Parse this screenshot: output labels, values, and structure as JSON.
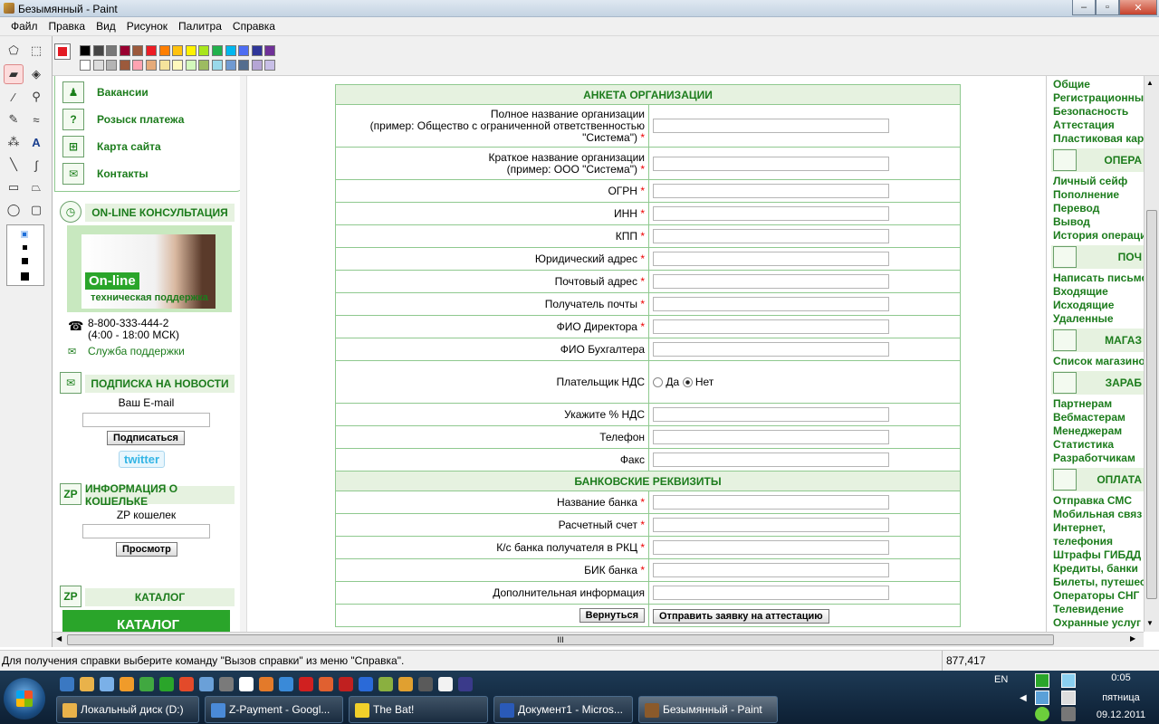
{
  "window": {
    "title": "Безымянный - Paint",
    "min": "–",
    "max": "▫",
    "close": "✕"
  },
  "menu": [
    "Файл",
    "Правка",
    "Вид",
    "Рисунок",
    "Палитра",
    "Справка"
  ],
  "palette": {
    "primary": "#e31b23",
    "row1": [
      "#000000",
      "#464646",
      "#787878",
      "#990030",
      "#9c5a3c",
      "#ed1c24",
      "#ff7e00",
      "#ffc20e",
      "#fff200",
      "#a8e61d",
      "#22b14c",
      "#00b7ef",
      "#4d6df3",
      "#2f3699",
      "#6f3198"
    ],
    "row2": [
      "#ffffff",
      "#dcdcdc",
      "#b4b4b4",
      "#9c5a3c",
      "#ffa3b1",
      "#e5aa7a",
      "#f5e49c",
      "#fff9bd",
      "#d3f9bc",
      "#9dbb61",
      "#99d9ea",
      "#709ad1",
      "#546d8e",
      "#b5a5d5",
      "#c8bfe7"
    ]
  },
  "site_left": {
    "menu": [
      "Вакансии",
      "Розыск платежа",
      "Карта сайта",
      "Контакты"
    ],
    "online_head": "ON-LINE КОНСУЛЬТАЦИЯ",
    "banner_main": "On-line",
    "banner_sub": "техническая поддержка",
    "phone": "8-800-333-444-2",
    "hours": "(4:00 - 18:00 МСК)",
    "support": "Служба поддержки",
    "news_head": "ПОДПИСКА НА НОВОСТИ",
    "email_label": "Ваш E-mail",
    "subscribe": "Подписаться",
    "twitter": "twitter",
    "wallet_head": "ИНФОРМАЦИЯ О КОШЕЛЬКЕ",
    "wallet_label": "ZP кошелек",
    "view": "Просмотр",
    "catalog_head": "КАТАЛОГ",
    "catalog_banner": "КАТАЛОГ"
  },
  "form": {
    "section1": "АНКЕТА ОРГАНИЗАЦИИ",
    "full_name": "Полное название организации",
    "full_name_hint": "(пример: Общество с ограниченной ответственностью",
    "full_name_hint2": "\"Система\")",
    "short_name": "Краткое название организации",
    "short_name_hint": "(пример: ООО \"Система\")",
    "rows": [
      "ОГРН",
      "ИНН",
      "КПП",
      "Юридический адрес",
      "Почтовый адрес",
      "Получатель почты",
      "ФИО Директора"
    ],
    "buh": "ФИО Бухгалтера",
    "nds": "Плательщик НДС",
    "nds_yes": "Да",
    "nds_no": "Нет",
    "nds_percent": "Укажите % НДС",
    "phone": "Телефон",
    "fax": "Факс",
    "section2": "БАНКОВСКИЕ РЕКВИЗИТЫ",
    "bank_rows": [
      "Название банка",
      "Расчетный счет",
      "К/с банка получателя в РКЦ",
      "БИК банка"
    ],
    "extra": "Дополнительная информация",
    "back": "Вернуться",
    "submit": "Отправить заявку на аттестацию",
    "required_mark": "*"
  },
  "site_right": {
    "g1": [
      "Общие",
      "Регистрационны",
      "Безопасность",
      "Аттестация",
      "Пластиковая кар"
    ],
    "h_oper": "ОПЕРА",
    "g2": [
      "Личный сейф",
      "Пополнение",
      "Перевод",
      "Вывод",
      "История операци"
    ],
    "h_mail": "ПОЧ",
    "g3": [
      "Написать письмо",
      "Входящие",
      "Исходящие",
      "Удаленные"
    ],
    "h_shop": "МАГАЗ",
    "g4": [
      "Список магазино"
    ],
    "h_earn": "ЗАРАБ",
    "g5": [
      "Партнерам",
      "Вебмастерам",
      "Менеджерам",
      "Статистика",
      "Разработчикам"
    ],
    "h_pay": "ОПЛАТА",
    "g6": [
      "Отправка СМС",
      "Мобильная связ",
      "Интернет,",
      "телефония",
      "Штрафы ГИБДД",
      "Кредиты, банки",
      "Билеты, путешес",
      "Операторы СНГ",
      "Телевидение",
      "Охранные услуг"
    ]
  },
  "status": {
    "help": "Для получения справки выберите команду \"Вызов справки\" из меню \"Справка\".",
    "coords": "877,417"
  },
  "taskbar": {
    "tasks": [
      "Локальный диск (D:)",
      "Z-Payment - Googl...",
      "The Bat!",
      "Документ1 - Micros...",
      "Безымянный - Paint"
    ],
    "lang": "EN",
    "time": "0:05",
    "day": "пятница",
    "date": "09.12.2011"
  },
  "scroll": {
    "grip": "III",
    "up": "▲",
    "down": "▼",
    "left": "◀",
    "right": "▶"
  }
}
